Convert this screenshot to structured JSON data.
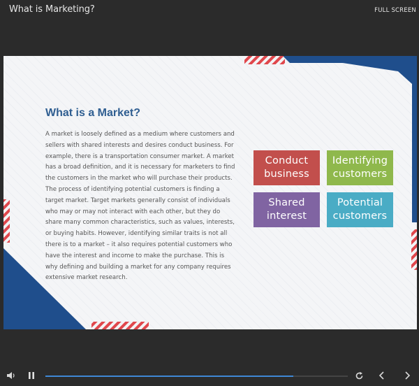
{
  "header": {
    "title": "What is Marketing?",
    "fullscreen_label": "FULL SCREEN"
  },
  "slide": {
    "heading": "What is a Market?",
    "body": "A market is loosely defined as a medium where customers and sellers with shared interests and desires conduct business. For example, there is a transportation consumer market. A market has a broad definition, and it is necessary for marketers to find the customers in the market who will purchase their products. The process of identifying potential customers is finding a target market. Target markets generally consist of individuals who may or may not interact with each other, but they do share many common characteristics, such as values, interests, or buying habits. However, identifying similar traits is not all there is to a market – it also requires potential customers who have the interest and income to make the purchase. This is why defining and building a market for any company requires extensive market research.",
    "boxes": [
      {
        "label": "Conduct business",
        "color": "#c24f4c"
      },
      {
        "label": "Identifying customers",
        "color": "#8fb84c"
      },
      {
        "label": "Shared interest",
        "color": "#8064a2"
      },
      {
        "label": "Potential customers",
        "color": "#4aacc5"
      }
    ],
    "accent_colors": {
      "navy": "#1f4e8c",
      "stripe_red": "#e0474c"
    }
  },
  "player": {
    "progress": 0.82,
    "icons": [
      "volume-icon",
      "pause-icon",
      "replay-icon",
      "previous-icon",
      "next-icon"
    ],
    "progress_color": "#3f88d6"
  }
}
